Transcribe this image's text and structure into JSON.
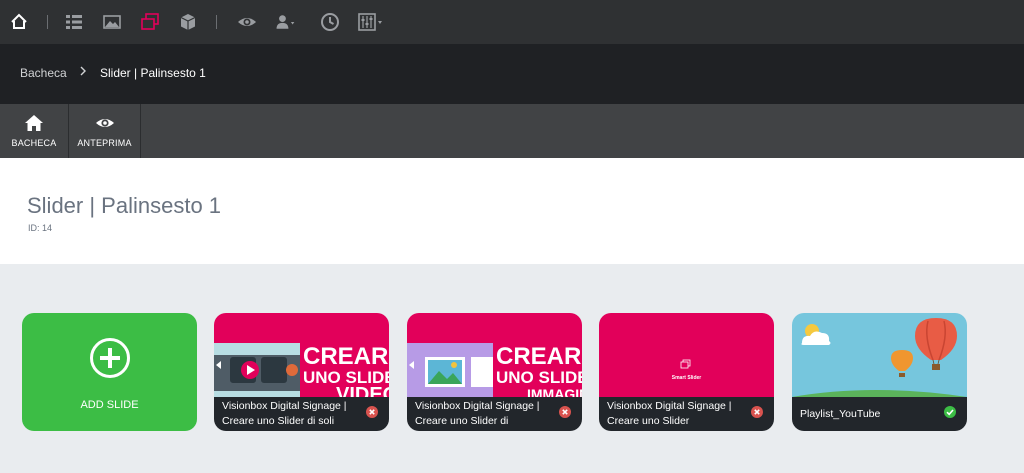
{
  "topbar": {
    "icons": [
      "home-icon",
      "list-icon",
      "image-icon",
      "slides-icon",
      "box-icon",
      "eye-icon",
      "users-icon",
      "clock-icon",
      "equalizer-icon"
    ],
    "active_color": "#e2005a"
  },
  "breadcrumb": {
    "home": "Bacheca",
    "current": "Slider | Palinsesto 1"
  },
  "actions": {
    "bacheca": "BACHECA",
    "anteprima": "ANTEPRIMA"
  },
  "page": {
    "title": "Slider | Palinsesto 1",
    "id": "ID: 14"
  },
  "cards": {
    "add_label": "ADD SLIDE",
    "slides": [
      {
        "caption": "Visionbox Digital Signage | Creare uno Slider di soli",
        "thumb_text_1": "CREARE",
        "thumb_text_2": "UNO SLIDER",
        "thumb_text_3": "VIDEO",
        "status": "error"
      },
      {
        "caption": "Visionbox Digital Signage | Creare uno Slider di",
        "thumb_text_1": "CREARE",
        "thumb_text_2": "UNO SLIDER",
        "thumb_text_3": "IMMAGINI",
        "status": "error"
      },
      {
        "caption": "Visionbox Digital Signage | Creare uno Slider",
        "thumb_text_1": "Smart Slider",
        "status": "error"
      },
      {
        "caption": "Playlist_YouTube",
        "status": "ok"
      }
    ]
  },
  "colors": {
    "brand_pink": "#e2005a",
    "add_green": "#3cbd45",
    "error_red": "#d9534f",
    "ok_green": "#3cbd45"
  }
}
